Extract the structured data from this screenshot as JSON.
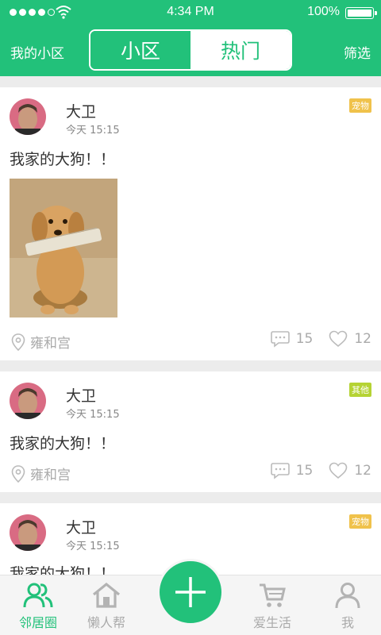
{
  "status_bar": {
    "time": "4:34 PM",
    "battery": "100%"
  },
  "header": {
    "left_link": "我的小区",
    "tabs": [
      {
        "label": "小区",
        "active": true
      },
      {
        "label": "热门",
        "active": false
      }
    ],
    "right_link": "筛选"
  },
  "posts": [
    {
      "username": "大卫",
      "time": "今天 15:15",
      "tag": "宠物",
      "tag_color": "#f0c24b",
      "text": "我家的大狗！！",
      "has_image": true,
      "location": "雍和宫",
      "comments": "15",
      "likes": "12"
    },
    {
      "username": "大卫",
      "time": "今天 15:15",
      "tag": "其他",
      "tag_color": "#b5d334",
      "text": "我家的大狗！！",
      "has_image": false,
      "location": "雍和宫",
      "comments": "15",
      "likes": "12"
    },
    {
      "username": "大卫",
      "time": "今天 15:15",
      "tag": "宠物",
      "tag_color": "#f0c24b",
      "text": "我家的大狗！！"
    }
  ],
  "tabbar": {
    "items": [
      {
        "label": "邻居圈",
        "icon": "people-icon",
        "active": true
      },
      {
        "label": "懒人帮",
        "icon": "home-icon",
        "active": false
      },
      {
        "label": "爱生活",
        "icon": "cart-icon",
        "active": false
      },
      {
        "label": "我",
        "icon": "user-icon",
        "active": false
      }
    ],
    "fab_icon": "plus-icon"
  },
  "colors": {
    "brand": "#22c17a",
    "muted": "#aaaaaa"
  }
}
